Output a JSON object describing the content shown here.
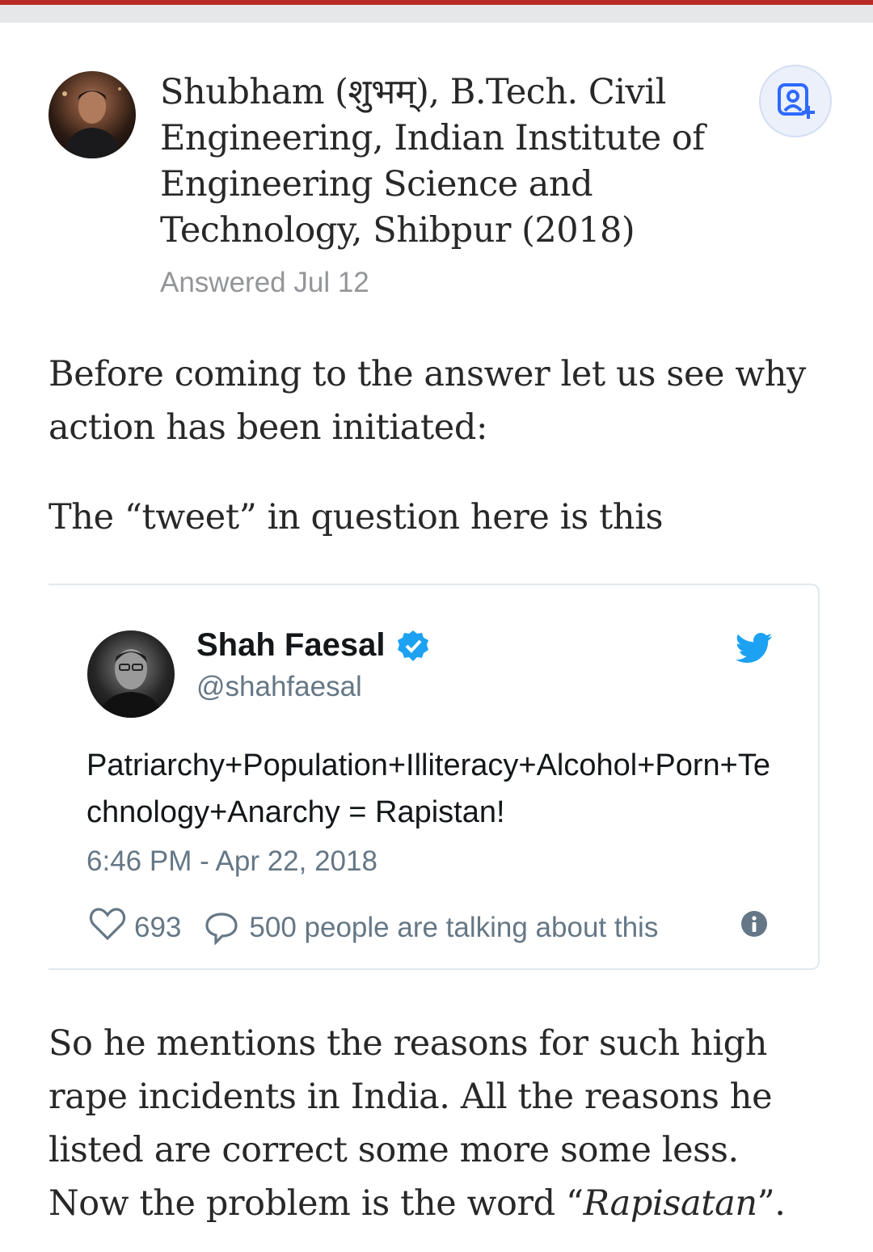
{
  "header": {
    "accent_color": "#b92b27"
  },
  "answer": {
    "author": {
      "credential": "Shubham (शुभम्), B.Tech. Civil Engineering, Indian Institute of Engineering Science and Technology, Shibpur (2018)",
      "avatar_icon": "user-photo"
    },
    "meta": "Answered Jul 12",
    "follow_icon": "add-person-icon",
    "paragraph_1": "Before coming to the answer let us see why action has been initiated:",
    "paragraph_2": "The “tweet” in question here is this",
    "paragraph_3_before": "So he mentions the reasons for such high rape incidents in India. All the reasons he listed are correct some more some less. Now the problem is the word “",
    "paragraph_3_italic": "Rapisatan",
    "paragraph_3_after": "”."
  },
  "tweet": {
    "name": "Shah Faesal",
    "handle": "@shahfaesal",
    "text": "Patriarchy+Population+Illiteracy+Alcohol+Porn+Technology+Anarchy = Rapistan!",
    "timestamp": "6:46 PM - Apr 22, 2018",
    "likes": "693",
    "talking": "500 people are talking about this",
    "brand_color": "#1da1f2"
  }
}
